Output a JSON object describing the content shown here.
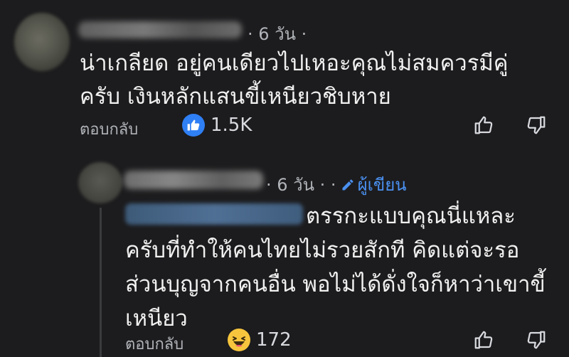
{
  "comment": {
    "time_meta": "· 6 วัน ·",
    "text_lines": [
      "น่าเกลียด อยู่คนเดียวไปเหอะคุณไม่สมควรมีคู่",
      "ครับ เงินหลักแสนขี้เหนียวชิบหาย"
    ],
    "reply_label": "ตอบกลับ",
    "reaction": {
      "icon": "like-reaction-icon",
      "count": "1.5K",
      "color": "#2f7ff5"
    }
  },
  "reply": {
    "time_meta": "· 6 วัน · ·",
    "author_badge": "ผู้เขียน",
    "text_lines": [
      "ตรรกะแบบคุณนี่แหละ",
      "ครับที่ทำให้คนไทยไม่รวยสักที คิดแต่จะรอ",
      "ส่วนบุญจากคนอื่น พอไม่ได้ดั่งใจก็หาว่าเขาขี้",
      "เหนียว"
    ],
    "reply_label": "ตอบกลับ",
    "reaction": {
      "icon": "haha-reaction-icon",
      "count": "172",
      "color": "#f7c53d"
    }
  },
  "colors": {
    "background": "#1c1c1e",
    "text": "#f0f0f0",
    "muted": "#b0b3b8",
    "author_accent": "#4a90f0"
  }
}
